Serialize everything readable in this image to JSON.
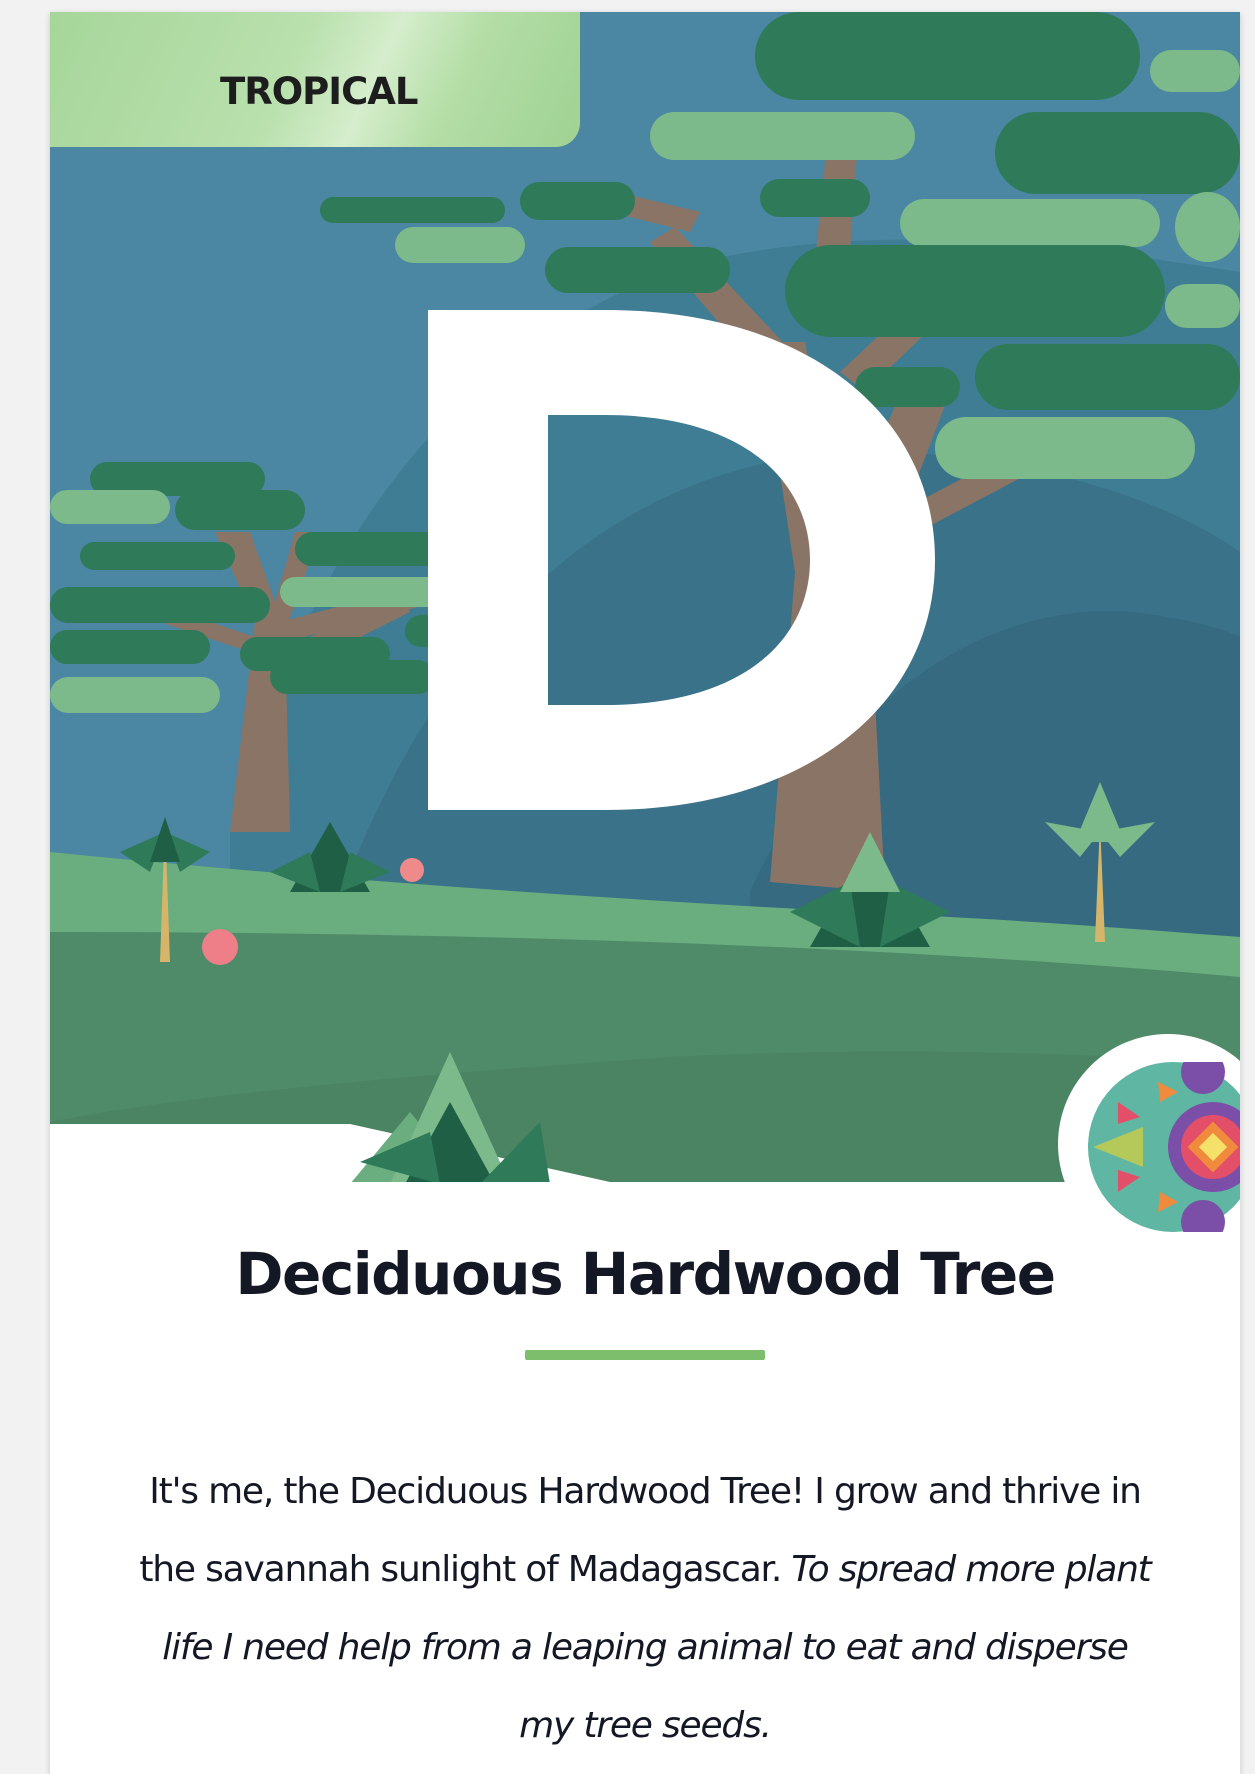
{
  "card": {
    "category": "TROPICAL",
    "hero_letter": "D",
    "title": "Deciduous Hardwood Tree",
    "description_intro": "It's me, the Deciduous Hardwood Tree! I grow and thrive in the savannah sunlight of Madagascar. ",
    "description_emphasis": "To spread more plant life I need help from a leaping animal to eat and disperse my tree seeds."
  },
  "colors": {
    "sky": "#4b86a3",
    "badge": "#a6d69a",
    "divider": "#7dbe6d",
    "title_text": "#141824",
    "foliage_dark": "#2f7a59",
    "foliage_light": "#7cba8b",
    "trunk": "#8a7466",
    "ground": "#4f8b69"
  }
}
